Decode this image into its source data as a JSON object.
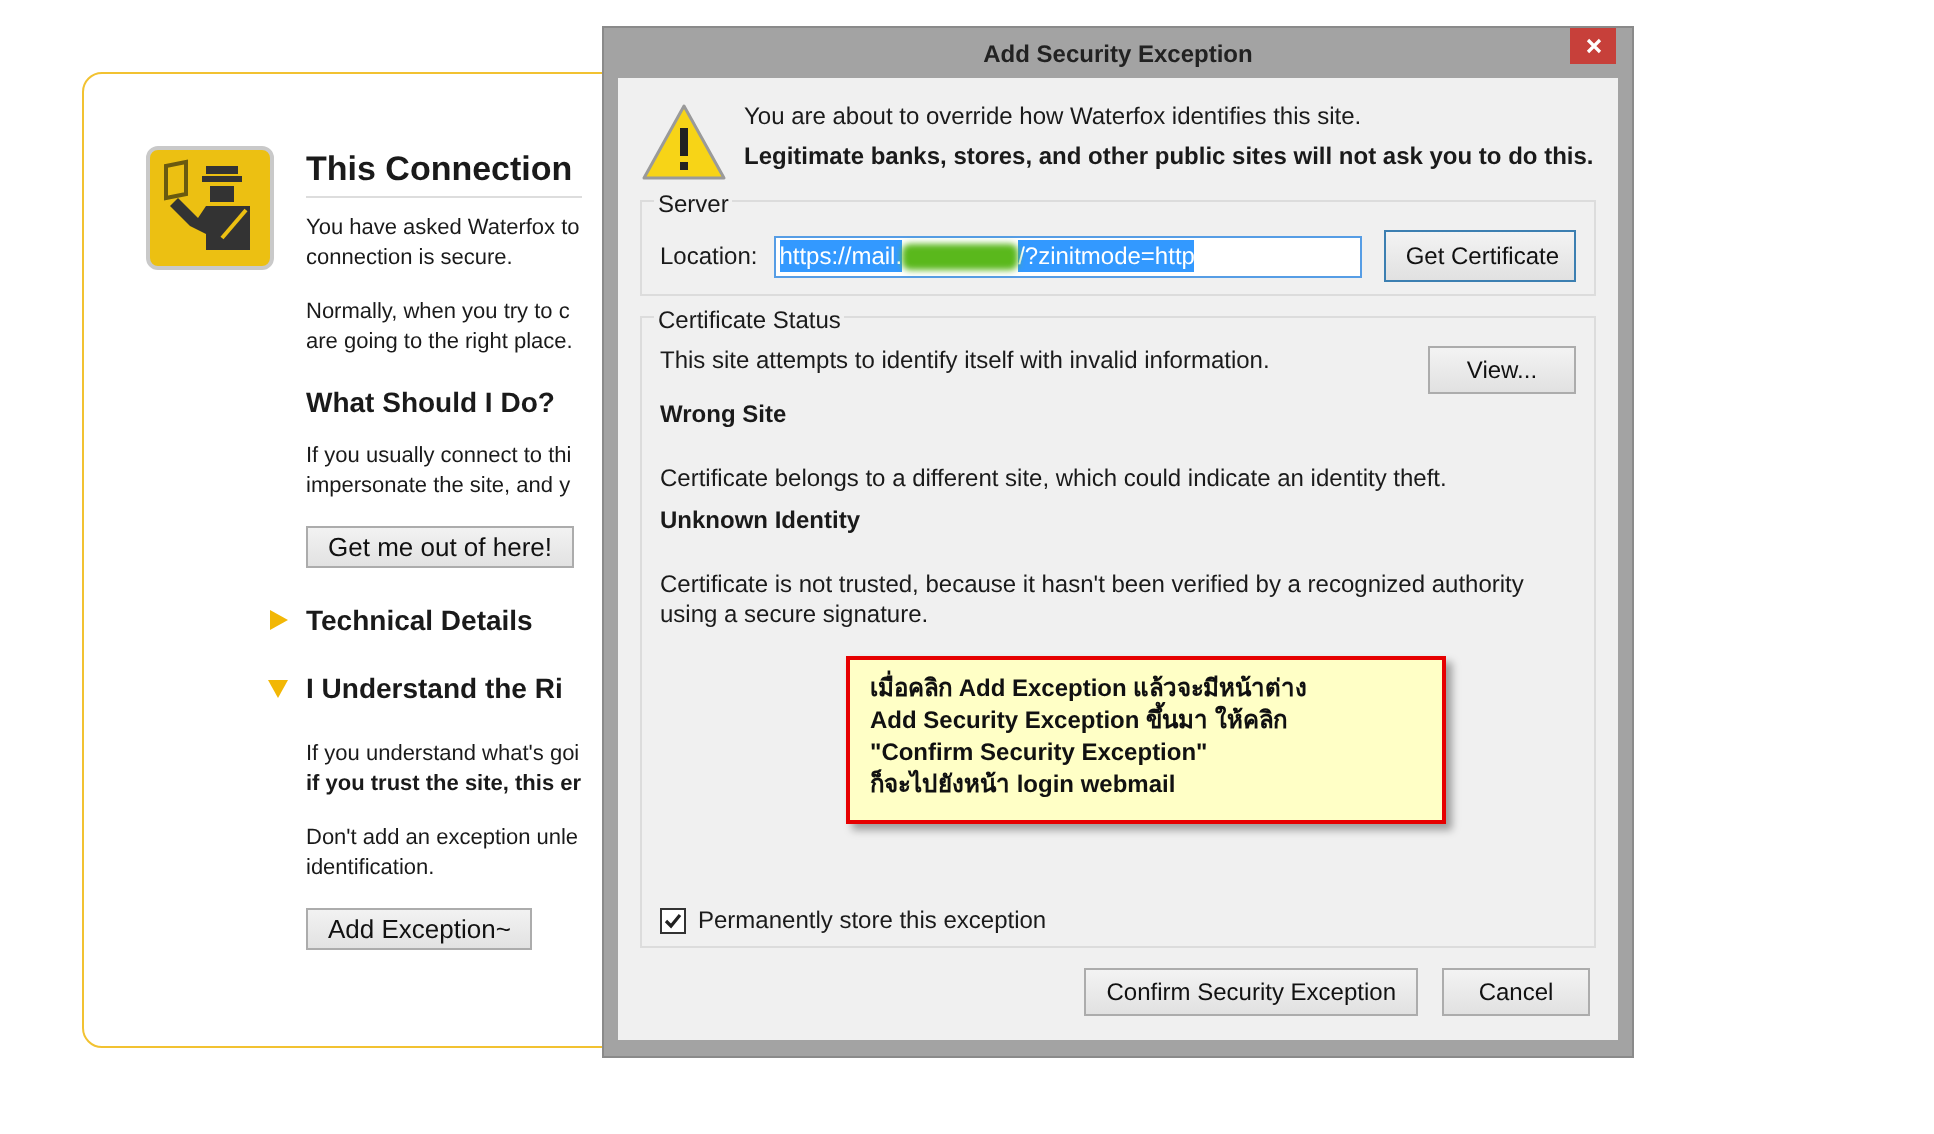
{
  "error_page": {
    "title": "This Connection",
    "paragraphs": [
      {
        "lines": [
          "You have asked Waterfox to",
          "connection is secure."
        ]
      },
      {
        "lines": [
          "Normally, when you try to c",
          "are going to the right place."
        ]
      }
    ],
    "what_heading": "What Should I Do?",
    "what_lines": [
      "If you usually connect to thi",
      "impersonate the site, and y"
    ],
    "escape_button": "Get me out of here!",
    "sections": [
      {
        "title": "Technical Details",
        "expanded": false
      },
      {
        "title": "I Understand the Ri",
        "expanded": true
      }
    ],
    "risk_paragraphs": [
      {
        "lines": [
          {
            "text": "If you understand what's goi",
            "bold": false
          },
          {
            "text": "if you trust the site, this er",
            "bold": true
          }
        ]
      },
      {
        "lines": [
          {
            "text": "Don't add an exception unle",
            "bold": false
          },
          {
            "text": "identification.",
            "bold": false
          }
        ]
      }
    ],
    "exception_button": "Add Exception~"
  },
  "dialog": {
    "title": "Add Security Exception",
    "warning": [
      {
        "text": "You are about to override how Waterfox identifies this site.",
        "bold": false
      },
      {
        "text": "Legitimate banks, stores, and other public sites will not ask you to do this.",
        "bold": true
      }
    ],
    "server": {
      "legend": "Server",
      "label": "Location:",
      "value_prefix": "https://mail.",
      "value_suffix": "/?zinitmode=http",
      "button": {
        "label": "Get Certificate"
      }
    },
    "status": {
      "legend": "Certificate Status",
      "summary": "This site attempts to identify itself with invalid information.",
      "view_button": {
        "label": "View..."
      },
      "problems": [
        {
          "title": "Wrong Site",
          "description": "Certificate belongs to a different site, which could indicate an identity theft."
        },
        {
          "title": "Unknown Identity",
          "description": "Certificate is not trusted, because it hasn't been verified by a recognized authority using a secure signature."
        }
      ]
    },
    "permanent": {
      "label": "Permanently store this exception",
      "checked": true
    },
    "buttons": [
      {
        "label": "Confirm Security Exception"
      },
      {
        "label": "Cancel"
      }
    ]
  },
  "note": {
    "lines": [
      "เมื่อคลิก Add Exception แล้วจะมีหน้าต่าง",
      "Add Security Exception ขึ้นมา ให้คลิก",
      "\"Confirm Security Exception\"",
      "ก็จะไปยังหน้า login webmail"
    ]
  }
}
